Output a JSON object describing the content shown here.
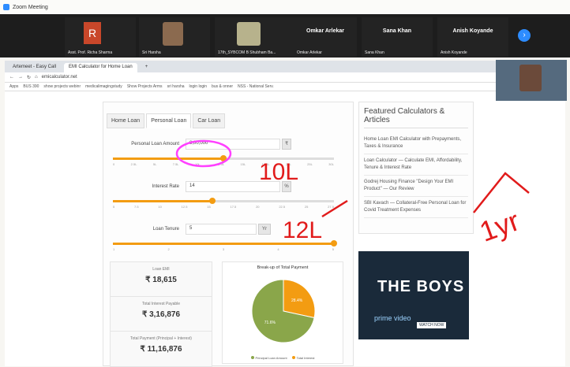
{
  "zoom": {
    "title": "Zoom Meeting"
  },
  "participants": [
    {
      "name": "Asst. Prof. Richa Sharma",
      "avatar": "R"
    },
    {
      "name": "Sri Harsha"
    },
    {
      "name": "17th_SYBCOM B Shubham Ba..."
    },
    {
      "name": "Omkar Arlekar"
    },
    {
      "name": "Sana Khan"
    },
    {
      "name": "Anish Koyande"
    }
  ],
  "browser": {
    "tabs": [
      {
        "label": "Artemeet - Easy Call"
      },
      {
        "label": "EMI Calculator for Home Loan"
      }
    ],
    "url": "emicalculator.net",
    "bookmarks": [
      "Apps",
      "BUS 390",
      "show projects webinr",
      "medicalimagingstudy",
      "Show Projects Arms",
      "sri harsha",
      "login login",
      "bus & onner",
      "NSS - National Serv."
    ]
  },
  "calc": {
    "tabs": [
      "Home Loan",
      "Personal Loan",
      "Car Loan"
    ],
    "amount": {
      "label": "Personal Loan Amount",
      "value": "8,00,000",
      "unit": "₹",
      "fraction": 0.5,
      "ticks": [
        "0",
        "2.5L",
        "5L",
        "7.5L",
        "10L",
        "12.5L",
        "15L",
        "17.5L",
        "20L",
        "25L",
        "30L"
      ]
    },
    "rate": {
      "label": "Interest Rate",
      "value": "14",
      "unit": "%",
      "fraction": 0.45,
      "ticks": [
        "5",
        "7.5",
        "10",
        "12.5",
        "15",
        "17.5",
        "20",
        "22.5",
        "25",
        "27.5"
      ]
    },
    "tenure": {
      "label": "Loan Tenure",
      "value": "5",
      "unit": "Yr",
      "fraction": 1.0,
      "ticks": [
        "1",
        "2",
        "3",
        "4",
        "5"
      ]
    }
  },
  "results": [
    {
      "title": "Loan EMI",
      "value": "₹ 18,615"
    },
    {
      "title": "Total Interest Payable",
      "value": "₹ 3,16,876"
    },
    {
      "title": "Total Payment (Principal + Interest)",
      "value": "₹ 11,16,876"
    }
  ],
  "pie": {
    "title": "Break-up of Total Payment",
    "principal_pct": 71.6,
    "interest_pct": 28.4,
    "principal_label": "71.6%",
    "interest_label": "28.4%",
    "legend": [
      "Principal Loan Amount",
      "Total Interest"
    ]
  },
  "featured": {
    "title": "Featured Calculators & Articles",
    "links": [
      "Home Loan EMI Calculator with Prepayments, Taxes & Insurance",
      "Loan Calculator — Calculate EMI, Affordability, Tenure & Interest Rate",
      "Godrej Housing Finance \"Design Your EMI Product\" — Our Review",
      "SBI Kavach — Collateral-Free Personal Loan for Covid Treatment Expenses"
    ]
  },
  "ad": {
    "title": "THE BOYS",
    "brand": "prime video",
    "cta": "WATCH NOW"
  },
  "annotations": [
    "10L",
    "12L",
    "1yr"
  ],
  "colors": {
    "principal": "#8aa64a",
    "interest": "#f39c12",
    "accent": "#f39c12",
    "ink": "#e11b1b",
    "circle": "#ff40ff"
  }
}
